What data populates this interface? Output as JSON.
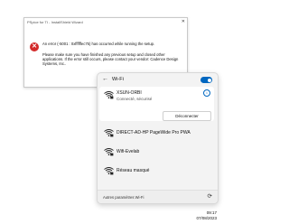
{
  "dialog": {
    "title": "PSpice for TI - InstallShield Wizard",
    "close_glyph": "✕",
    "icon": "error-icon",
    "message_1": "An error (-5001 : 0xffffffec75) has occurred while running the setup.",
    "message_2": "Please make sure you have finished any previous setup and closed other applications. If the error still occurs, please contact your vendor: Cadence Design Systems, Inc.."
  },
  "wifi": {
    "title": "Wi-Fi",
    "toggle_on": true,
    "accent": "#0067c0",
    "connected": {
      "name": "XSUN-ORBI",
      "status": "Connecté, sécurisé",
      "disconnect_label": "Déconnecter"
    },
    "networks": [
      {
        "name": "DIRECT-AD-HP PageWide Pro PWA"
      },
      {
        "name": "Wifi-Evelab"
      },
      {
        "name": "Réseau masqué"
      }
    ],
    "footer_label": "Autres paramètres Wi-Fi"
  },
  "clock": {
    "time": "09:17",
    "date": "07/08/2023"
  }
}
